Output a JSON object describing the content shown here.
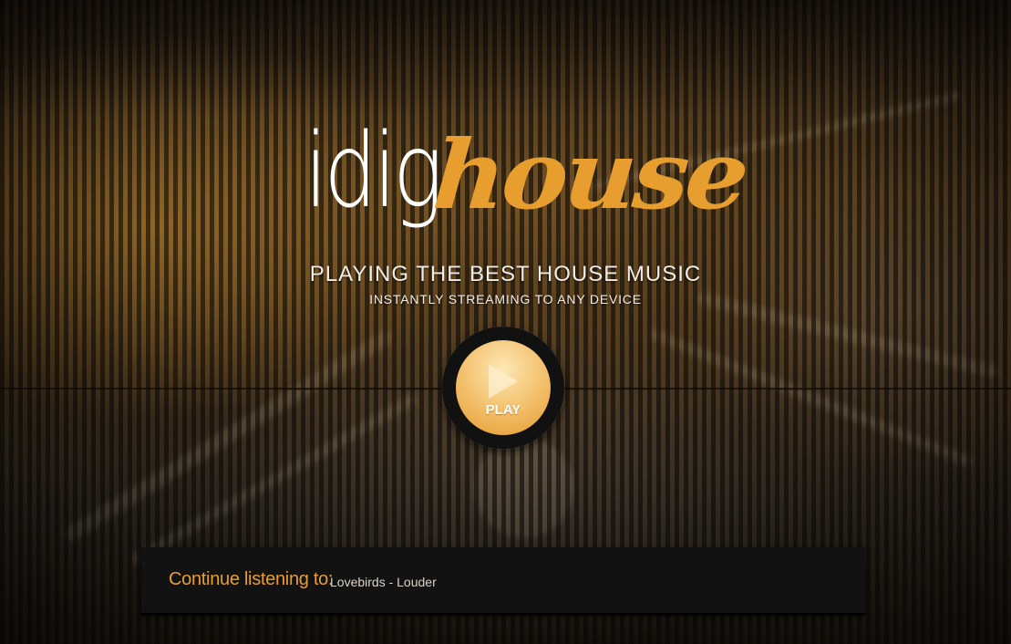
{
  "logo": {
    "part_white": "idig",
    "part_orange": "house"
  },
  "tagline": {
    "main": "PLAYING THE BEST HOUSE MUSIC",
    "sub": "INSTANTLY STREAMING TO ANY DEVICE"
  },
  "player": {
    "play_label": "PLAY",
    "play_icon": "play-triangle-icon"
  },
  "continue": {
    "label": "Continue listening to:",
    "track": "Lovebirds - Louder"
  },
  "colors": {
    "accent": "#e89e2f",
    "bar_background": "#121212",
    "text_light": "#f2ede4"
  }
}
